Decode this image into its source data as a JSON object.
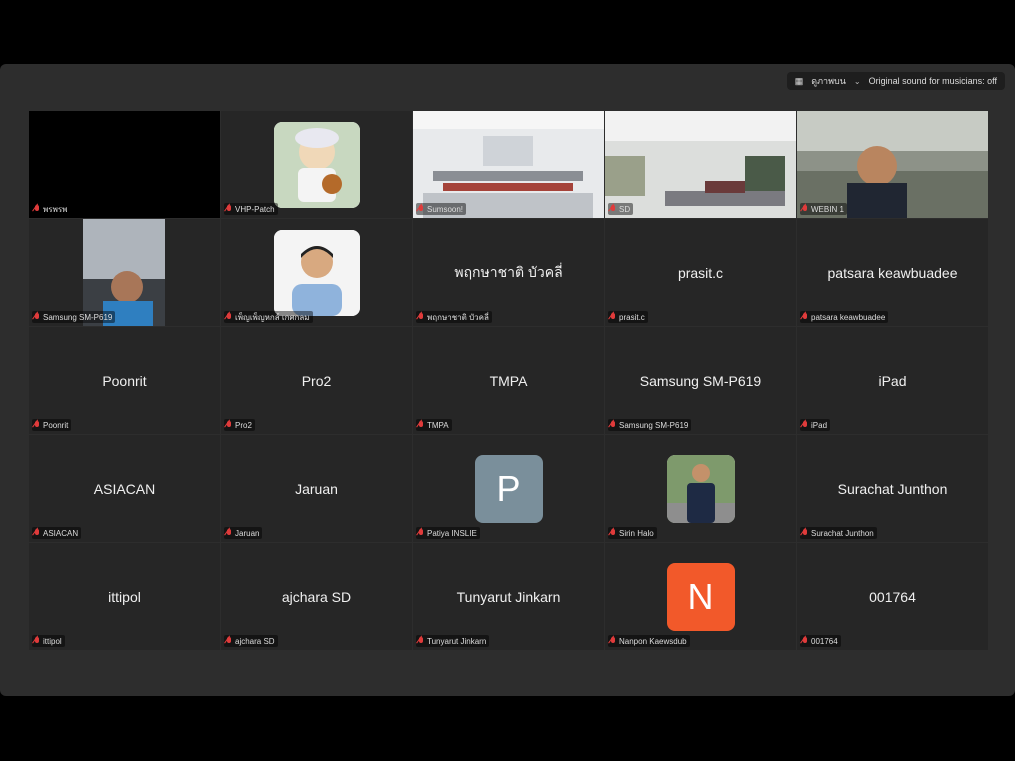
{
  "topbar": {
    "view_label": "ดูภาพบน",
    "original_sound": "Original sound for musicians: off"
  },
  "tiles": [
    {
      "name": "พรพรพ",
      "type": "black"
    },
    {
      "name": "VHP-Patch",
      "type": "cartoon"
    },
    {
      "name": "Sumsoon!",
      "type": "room1"
    },
    {
      "name": "SD",
      "type": "room2"
    },
    {
      "name": "WEBIN 1",
      "type": "speaker",
      "active": true
    },
    {
      "name": "Samsung SM-P619",
      "type": "car"
    },
    {
      "name": "เพ็ญเพ็ญหกส์ เกศกลม",
      "type": "portrait"
    },
    {
      "name": "พฤกษาชาติ บัวคลี่",
      "center": "พฤกษาชาติ บัวคลี่"
    },
    {
      "name": "prasit.c",
      "center": "prasit.c"
    },
    {
      "name": "patsara keawbuadee",
      "center": "patsara keawbuadee"
    },
    {
      "name": "Poonrit",
      "center": "Poonrit"
    },
    {
      "name": "Pro2",
      "center": "Pro2"
    },
    {
      "name": "TMPA",
      "center": "TMPA"
    },
    {
      "name": "Samsung SM-P619",
      "center": "Samsung SM-P619"
    },
    {
      "name": "iPad",
      "center": "iPad"
    },
    {
      "name": "ASIACAN",
      "center": "ASIACAN"
    },
    {
      "name": "Jaruan",
      "center": "Jaruan"
    },
    {
      "name": "Patiya INSLIE",
      "avatar": "P",
      "avatar_color": "#7a8f9b"
    },
    {
      "name": "Sirin Halo",
      "type": "suit"
    },
    {
      "name": "Surachat Junthon",
      "center": "Surachat Junthon"
    },
    {
      "name": "ittipol",
      "center": "ittipol"
    },
    {
      "name": "ajchara SD",
      "center": "ajchara SD"
    },
    {
      "name": "Tunyarut Jinkarn",
      "center": "Tunyarut Jinkarn"
    },
    {
      "name": "Nanpon Kaewsdub",
      "avatar": "N",
      "avatar_color": "#f2592a"
    },
    {
      "name": "001764",
      "center": "001764"
    }
  ]
}
